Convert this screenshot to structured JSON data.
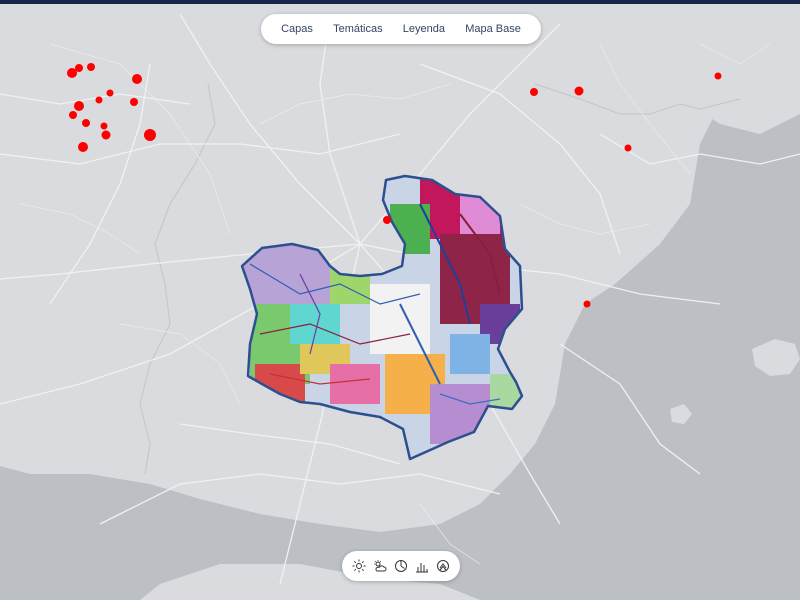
{
  "menu": {
    "items": [
      {
        "label": "Capas"
      },
      {
        "label": "Temáticas"
      },
      {
        "label": "Leyenda"
      },
      {
        "label": "Mapa Base"
      }
    ]
  },
  "toolbar": {
    "buttons": [
      {
        "icon": "sun-icon"
      },
      {
        "icon": "cloud-sun-icon"
      },
      {
        "icon": "gauge-icon"
      },
      {
        "icon": "bar-chart-icon"
      },
      {
        "icon": "layers-icon"
      }
    ]
  },
  "colors": {
    "sea": "#bcc0c5",
    "land": "#d9dbde",
    "roads": "#f2f3f5",
    "region_outline": "#2c4f8f",
    "markers": "#ff0000",
    "header": "#14264a",
    "menu_text": "#344563"
  }
}
